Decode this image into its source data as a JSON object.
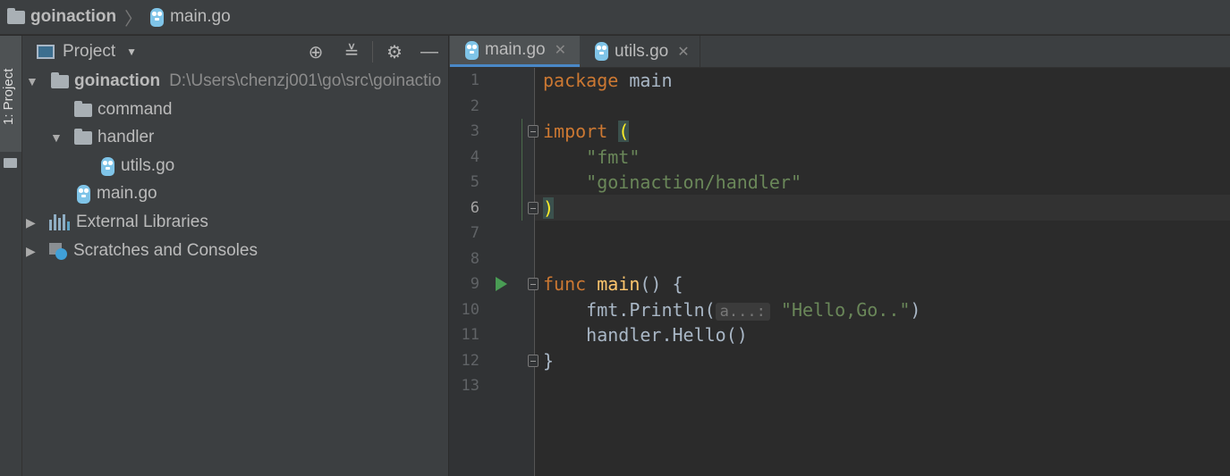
{
  "breadcrumb": {
    "project": "goinaction",
    "separator": "〉",
    "file": "main.go"
  },
  "toolstrip": {
    "project_tab": "1: Project"
  },
  "project_panel": {
    "title": "Project",
    "tree": [
      {
        "label": "goinaction",
        "path": "D:\\Users\\chenzj001\\go\\src\\goinactio",
        "expanded": true,
        "icon": "folder-icon"
      },
      {
        "label": "command",
        "icon": "folder-icon"
      },
      {
        "label": "handler",
        "expanded": true,
        "icon": "folder-icon"
      },
      {
        "label": "utils.go",
        "icon": "go-file-icon"
      },
      {
        "label": "main.go",
        "icon": "go-file-icon"
      },
      {
        "label": "External Libraries",
        "expanded": false,
        "icon": "libraries-icon"
      },
      {
        "label": "Scratches and Consoles",
        "expanded": false,
        "icon": "scratches-icon"
      }
    ]
  },
  "editor_tabs": [
    {
      "label": "main.go",
      "active": true
    },
    {
      "label": "utils.go",
      "active": false
    }
  ],
  "editor": {
    "current_line": 6,
    "line_numbers": [
      "1",
      "2",
      "3",
      "4",
      "5",
      "6",
      "7",
      "8",
      "9",
      "10",
      "11",
      "12",
      "13"
    ],
    "code": {
      "l1_kw": "package",
      "l1_rest": " main",
      "l3_kw": "import",
      "l3_paren": "(",
      "l4_str": "\"fmt\"",
      "l5_str": "\"goinaction/handler\"",
      "l6_paren": ")",
      "l9_kw": "func",
      "l9_fn": "main",
      "l9_rest": "() {",
      "l10_call": "fmt.Println(",
      "l10_hint": "a...:",
      "l10_str": "\"Hello,Go..\"",
      "l10_close": ")",
      "l11": "handler.Hello()",
      "l12": "}"
    }
  },
  "colors": {
    "keyword": "#cc7832",
    "string": "#6a8759",
    "function": "#ffc66d",
    "tab_underline": "#4a88c7",
    "run_icon": "#499c54"
  }
}
